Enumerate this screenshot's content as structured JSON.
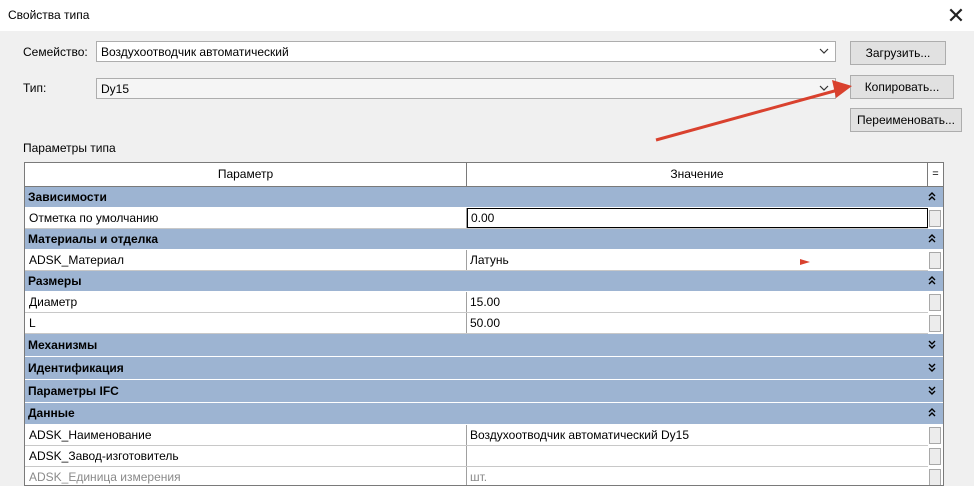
{
  "window": {
    "title": "Свойства типа",
    "close_icon": "close-icon"
  },
  "family": {
    "label": "Семейство:",
    "value": "Воздухоотводчик автоматический"
  },
  "type": {
    "label": "Тип:",
    "value": "Dy15"
  },
  "buttons": {
    "load": "Загрузить...",
    "copy": "Копировать...",
    "rename": "Переименовать..."
  },
  "params": {
    "section_label": "Параметры типа",
    "col_param": "Параметр",
    "col_value": "Значение",
    "col_eq": "="
  },
  "groups": {
    "g1": {
      "name": "Зависимости",
      "state": "expanded"
    },
    "g2": {
      "name": "Материалы и отделка",
      "state": "expanded"
    },
    "g3": {
      "name": "Размеры",
      "state": "expanded"
    },
    "g4": {
      "name": "Механизмы",
      "state": "collapsed"
    },
    "g5": {
      "name": "Идентификация",
      "state": "collapsed"
    },
    "g6": {
      "name": "Параметры IFC",
      "state": "collapsed"
    },
    "g7": {
      "name": "Данные",
      "state": "expanded"
    }
  },
  "rows": {
    "r1": {
      "name": "Отметка по умолчанию",
      "value": "0.00"
    },
    "r2": {
      "name": "ADSK_Материал",
      "value": "Латунь"
    },
    "r3": {
      "name": "Диаметр",
      "value": "15.00"
    },
    "r4": {
      "name": "L",
      "value": "50.00"
    },
    "r5": {
      "name": "ADSK_Наименование",
      "value": "Воздухоотводчик автоматический Dy15"
    },
    "r6": {
      "name": "ADSK_Завод-изготовитель",
      "value": ""
    },
    "r7": {
      "name": "ADSK_Единица измерения",
      "value": "шт."
    }
  },
  "colors": {
    "group_bg": "#9db4d2",
    "annotation_arrow": "#d9412e"
  }
}
